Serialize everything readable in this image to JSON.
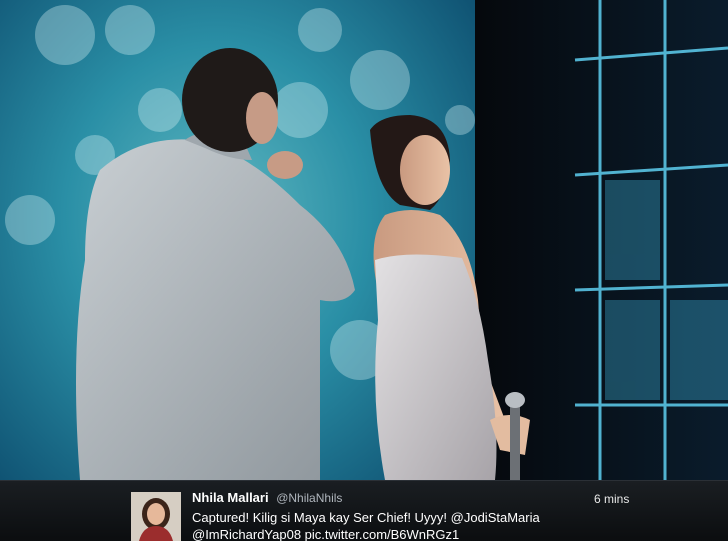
{
  "tweet": {
    "display_name": "Nhila Mallari",
    "handle": "@NhilaNhils",
    "time": "6 mins",
    "text_line1": "Captured! Kilig si Maya kay Ser Chief! Uyyy! @JodiStaMaria",
    "text_line2": "@ImRichardYap08 pic.twitter.com/B6WnRGz1"
  },
  "photo": {
    "subject_icon": "stage-photo",
    "colors": {
      "screen": "#1a7fa0",
      "stage": "#0a1a2a",
      "light": "#4fd2f0"
    }
  }
}
